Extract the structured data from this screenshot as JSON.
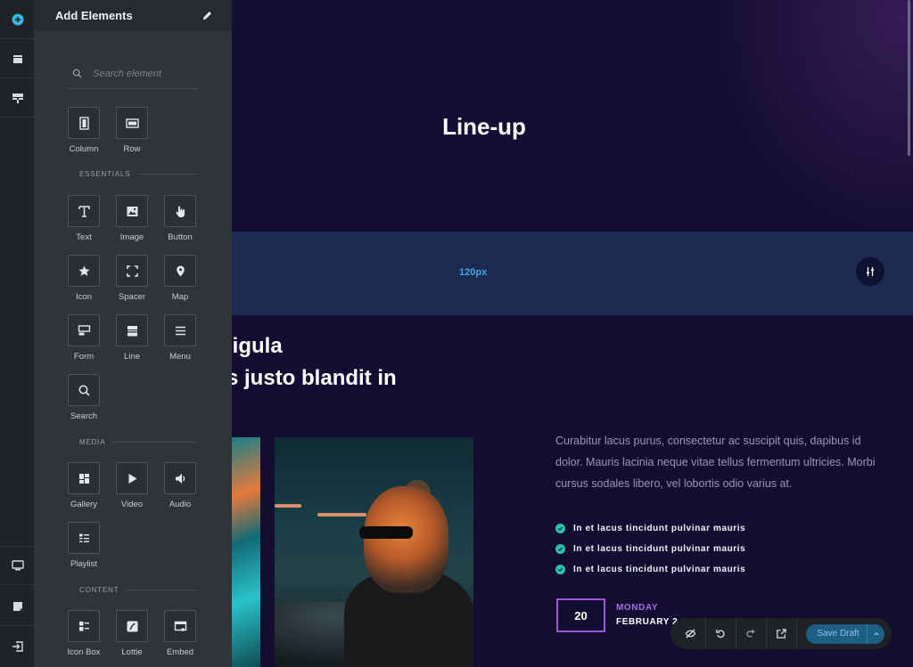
{
  "panel": {
    "title": "Add Elements",
    "search_placeholder": "Search element",
    "layout_items": [
      {
        "label": "Column",
        "icon": "column-icon"
      },
      {
        "label": "Row",
        "icon": "row-icon"
      }
    ],
    "sections": {
      "essentials": "ESSENTIALS",
      "media": "MEDIA",
      "content": "CONTENT"
    },
    "essentials_items": [
      {
        "label": "Text",
        "icon": "text-icon"
      },
      {
        "label": "Image",
        "icon": "image-icon"
      },
      {
        "label": "Button",
        "icon": "pointer-icon"
      },
      {
        "label": "Icon",
        "icon": "star-icon"
      },
      {
        "label": "Spacer",
        "icon": "spacer-icon"
      },
      {
        "label": "Map",
        "icon": "map-pin-icon"
      },
      {
        "label": "Form",
        "icon": "form-icon"
      },
      {
        "label": "Line",
        "icon": "line-icon"
      },
      {
        "label": "Menu",
        "icon": "menu-icon"
      },
      {
        "label": "Search",
        "icon": "search-icon"
      }
    ],
    "media_items": [
      {
        "label": "Gallery",
        "icon": "gallery-icon"
      },
      {
        "label": "Video",
        "icon": "play-icon"
      },
      {
        "label": "Audio",
        "icon": "speaker-icon"
      },
      {
        "label": "Playlist",
        "icon": "playlist-icon"
      }
    ],
    "content_items": [
      {
        "label": "Icon Box",
        "icon": "icon-box-icon"
      },
      {
        "label": "Lottie",
        "icon": "lottie-icon"
      },
      {
        "label": "Embed",
        "icon": "embed-icon"
      }
    ]
  },
  "canvas": {
    "hero_title": "Line-up",
    "spacer_label": "120px",
    "heading_line1": "ligula",
    "heading_line2": "s justo blandit in",
    "body_text": "Curabitur lacus purus, consectetur ac suscipit quis, dapibus id dolor. Mauris lacinia neque vitae tellus fermentum ultricies. Morbi cursus sodales libero, vel lobortis odio varius at.",
    "checklist": [
      "In et lacus tincidunt pulvinar mauris",
      "In et lacus tincidunt pulvinar mauris",
      "In et lacus tincidunt pulvinar mauris"
    ],
    "date_day_number": "20",
    "date_weekday": "MONDAY",
    "date_month": "FEBRUARY 2"
  },
  "toolbar": {
    "save_label": "Save Draft"
  },
  "colors": {
    "accent_cyan": "#41a9e5",
    "check_green": "#28c2a8",
    "date_purple": "#a66ee3",
    "save_blue": "#1e5f84"
  }
}
